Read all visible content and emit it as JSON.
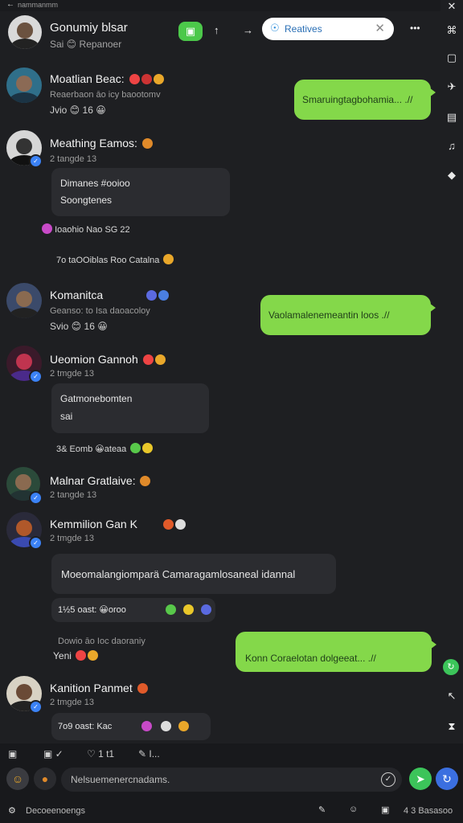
{
  "topbar": {
    "back": "←",
    "title": "nammanmm"
  },
  "header": {
    "title": "Gonumiy blsar",
    "subtitle": "Sai 😊 Repanoer",
    "buttons": [
      "▣",
      "↑",
      "→"
    ],
    "search_value": "Reatives",
    "more": "•••"
  },
  "rail_icons": [
    "✕",
    "⌘",
    "▢",
    "✈",
    "▤",
    "♫",
    "◆"
  ],
  "rail_bottom": [
    "↖",
    "⧗"
  ],
  "messages": [
    {
      "name": "Moatlian Beac:",
      "meta1": "Reaerbaon āo icy baootomv",
      "meta2": "Jvio 😊 16 😀"
    },
    {
      "name": "Meathing Eamos:",
      "meta1": "2 tangde 13",
      "bubble1": "Dimanes #ooioo",
      "bubble2": "Soongtenes",
      "react1": "Ioaohio   Nao SG 22",
      "react2": "7o taOOiblas   Roo  Catalna"
    },
    {
      "name": "Komanitca",
      "meta1": "Geanso: to Isa daoacoloy",
      "meta2": "Svio 😊 16 😀"
    },
    {
      "name": "Ueomion Gannoh",
      "meta1": "2 tmgde 13",
      "bubble1": "Gatmonebomten",
      "bubble2": "sai",
      "react1": "3& Eomb  😀ateaa"
    },
    {
      "name": "Malnar Gratlaive:",
      "meta1": "2 tangde 13"
    },
    {
      "name": "Kemmilion Gan K",
      "meta1": "2 tmgde 13",
      "bubble1": "Moeomalangiomparä Camaragamlosaneal idannal",
      "react1": "1½5 oast:  😀oroo"
    },
    {
      "name": "Kanition Panmet",
      "meta1": "2 tmgde 13",
      "react1": "7o9 oast:   Kac"
    }
  ],
  "outgoing": [
    {
      "text": "Smaruingtagbohamia... .//"
    },
    {
      "text": "Vaolamalenemeantin    loos .//"
    },
    {
      "text": "Konn   Coraelotan   dolgeeat... .//"
    }
  ],
  "misc_text": {
    "pre_outgoing3": "Dowio āo Ioc daoraniy",
    "yeni": "Yeni"
  },
  "bottom": {
    "tools": [
      "▣",
      "▣ ✓",
      "♡ 1 t1",
      "✎ I..."
    ],
    "input_placeholder": "Nelsuemenercnadams.",
    "footer_left": "Decoeenoengs",
    "footer_right": "4 3 Basasoo"
  }
}
